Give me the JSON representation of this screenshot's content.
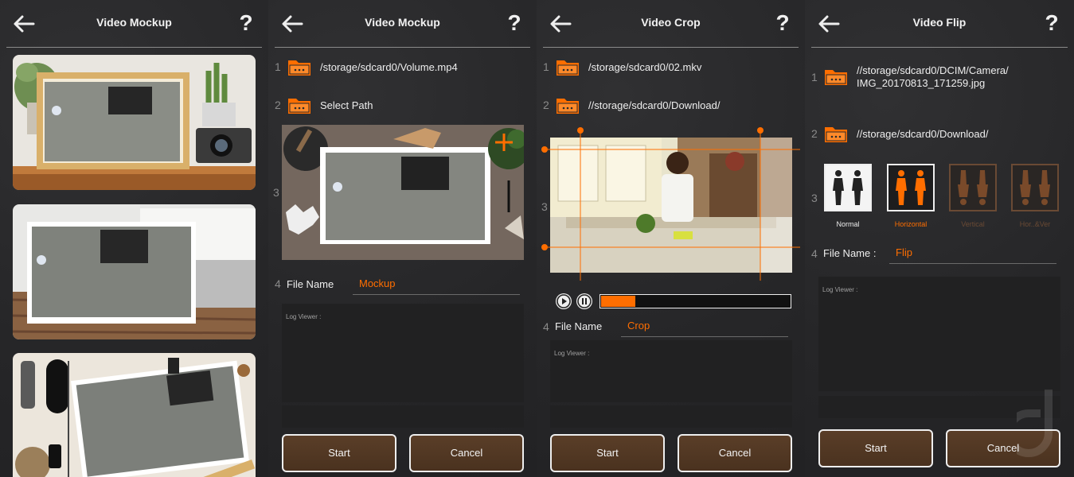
{
  "accent": "#ff6e00",
  "panels": [
    {
      "title": "Video Mockup",
      "help": "?"
    },
    {
      "title": "Video Mockup",
      "help": "?",
      "steps": [
        "1",
        "2",
        "3",
        "4"
      ],
      "source_path": "/storage/sdcard0/Volume.mp4",
      "dest_path": "Select Path",
      "file_name_label": "File Name",
      "file_name_value": "Mockup",
      "log_label": "Log Viewer :",
      "start": "Start",
      "cancel": "Cancel"
    },
    {
      "title": "Video Crop",
      "help": "?",
      "steps": [
        "1",
        "2",
        "3",
        "4"
      ],
      "source_path": "/storage/sdcard0/02.mkv",
      "dest_path": "//storage/sdcard0/Download/",
      "progress": 0.18,
      "file_name_label": "File Name",
      "file_name_value": "Crop",
      "log_label": "Log Viewer :",
      "start": "Start",
      "cancel": "Cancel"
    },
    {
      "title": "Video Flip",
      "help": "?",
      "steps": [
        "1",
        "2",
        "3",
        "4"
      ],
      "source_path_line1": "//storage/sdcard0/DCIM/Camera/",
      "source_path_line2": "IMG_20170813_171259.jpg",
      "dest_path": "//storage/sdcard0/Download/",
      "flip_options": [
        {
          "label": "Normal",
          "icon": "figures-normal-icon"
        },
        {
          "label": "Horizontal",
          "icon": "figures-horizontal-icon",
          "selected": true
        },
        {
          "label": "Vertical",
          "icon": "figures-vertical-icon"
        },
        {
          "label": "Hor..&Ver",
          "icon": "figures-hor-ver-icon"
        }
      ],
      "file_name_label": "File Name :",
      "file_name_value": "Flip",
      "log_label": "Log Viewer :",
      "start": "Start",
      "cancel": "Cancel"
    }
  ]
}
